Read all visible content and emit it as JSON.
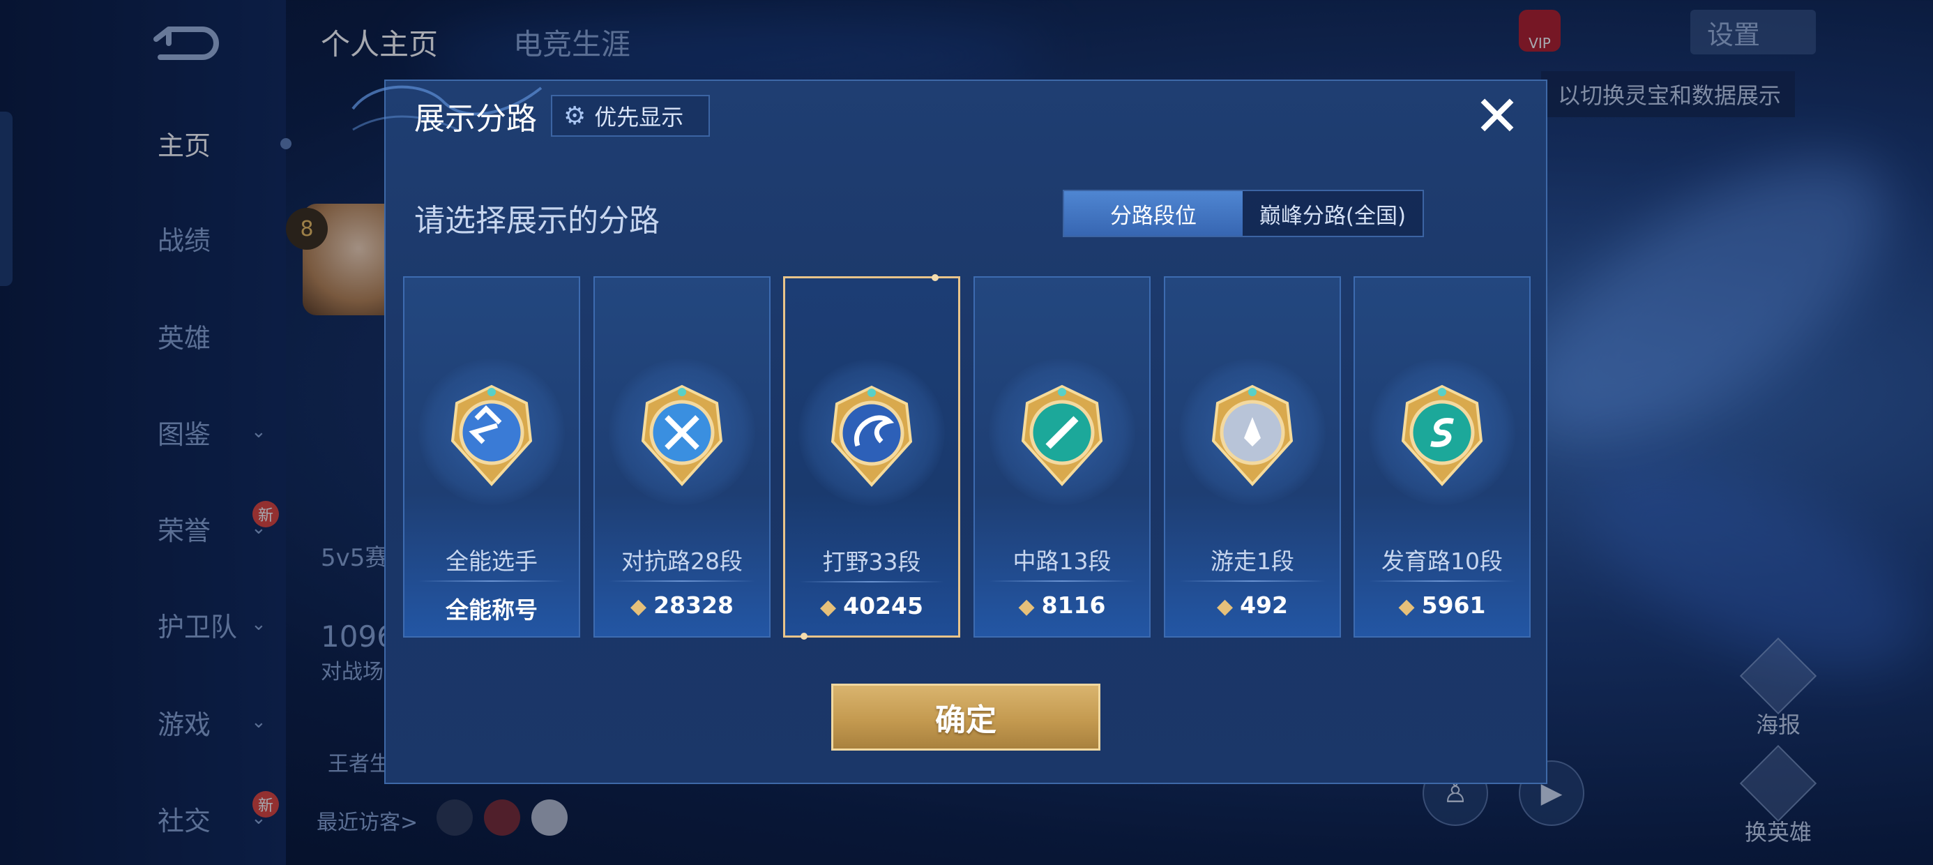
{
  "background": {
    "tabs": [
      {
        "label": "个人主页",
        "active": true
      },
      {
        "label": "电竞生涯",
        "active": false
      }
    ],
    "nav": [
      {
        "label": "主页",
        "active": true,
        "chevron": false,
        "new": false
      },
      {
        "label": "战绩",
        "active": false,
        "chevron": false,
        "new": false
      },
      {
        "label": "英雄",
        "active": false,
        "chevron": false,
        "new": false
      },
      {
        "label": "图鉴",
        "active": false,
        "chevron": true,
        "new": false
      },
      {
        "label": "荣誉",
        "active": false,
        "chevron": true,
        "new": true
      },
      {
        "label": "护卫队",
        "active": false,
        "chevron": true,
        "new": false
      },
      {
        "label": "游戏",
        "active": false,
        "chevron": true,
        "new": false
      },
      {
        "label": "社交",
        "active": false,
        "chevron": true,
        "new": true
      }
    ],
    "new_badge": "新",
    "level": "8",
    "partial_texts": {
      "mode": "5v5赛",
      "count": "1096",
      "battle": "对战场",
      "king": "王者生",
      "visitors": "最近访客>"
    },
    "settings_label": "设置",
    "hint": "以切换灵宝和数据展示",
    "side_buttons": [
      "海报",
      "换英雄"
    ],
    "vip_label": "VIP",
    "accent_color": "#e9c48a"
  },
  "modal": {
    "title": "展示分路",
    "priority_label": "优先显示",
    "close_icon": "close-icon",
    "subtitle": "请选择展示的分路",
    "segments": [
      {
        "label": "分路段位",
        "active": true
      },
      {
        "label": "巅峰分路(全国)",
        "active": false
      }
    ],
    "cards": [
      {
        "role": "全能选手",
        "score": "全能称号",
        "has_points": false,
        "selected": false,
        "badge": "all-round-badge-icon"
      },
      {
        "role": "对抗路28段",
        "score": "28328",
        "has_points": true,
        "selected": false,
        "badge": "clash-lane-badge-icon"
      },
      {
        "role": "打野33段",
        "score": "40245",
        "has_points": true,
        "selected": true,
        "badge": "jungle-badge-icon"
      },
      {
        "role": "中路13段",
        "score": "8116",
        "has_points": true,
        "selected": false,
        "badge": "mid-lane-badge-icon"
      },
      {
        "role": "游走1段",
        "score": "492",
        "has_points": true,
        "selected": false,
        "badge": "roam-badge-icon"
      },
      {
        "role": "发育路10段",
        "score": "5961",
        "has_points": true,
        "selected": false,
        "badge": "farm-lane-badge-icon"
      }
    ],
    "confirm_label": "确定"
  }
}
